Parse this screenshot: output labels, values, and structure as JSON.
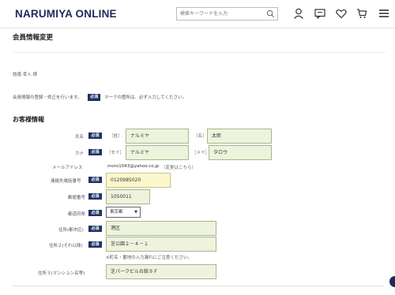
{
  "header": {
    "logo": "NARUMIYA ONLINE",
    "search_placeholder": "検索キーワードを入力"
  },
  "page": {
    "title": "会員情報変更",
    "username": "詰徳 幸入 様",
    "intro_before": "会員情報の登録・修正を行います。",
    "intro_after": "マークの箇所は、必ず入力してください。",
    "required_tag": "必須",
    "section_title": "お客様情報"
  },
  "form": {
    "name": {
      "label": "氏名",
      "sei_tag": "［姓］",
      "sei_value": "ナルミヤ",
      "mei_tag": "［名］",
      "mei_value": "太郎"
    },
    "kana": {
      "label": "カナ",
      "sei_tag": "［セイ］",
      "sei_value": "ナルミヤ",
      "mei_tag": "［メイ］",
      "mei_value": "タロウ"
    },
    "email": {
      "label": "メールアドレス",
      "value": "moro1043@yahoo.co.jp",
      "change_link": "（変更はこちら）"
    },
    "phone": {
      "label": "連絡先電話番号",
      "value": "0120985020"
    },
    "postal": {
      "label": "郵便番号",
      "value": "1050011"
    },
    "prefecture": {
      "label": "都道府県",
      "value": "東京都"
    },
    "address1": {
      "label": "住所(都市区)",
      "value": "港区"
    },
    "address2": {
      "label": "住所２(それ以降)",
      "value": "芝公園２－４－１",
      "note": "※町名・番地の入力漏れにご注意ください。"
    },
    "address3": {
      "label": "住所３(マンション名等)",
      "value": "芝パークビルＢ館９Ｆ"
    }
  }
}
